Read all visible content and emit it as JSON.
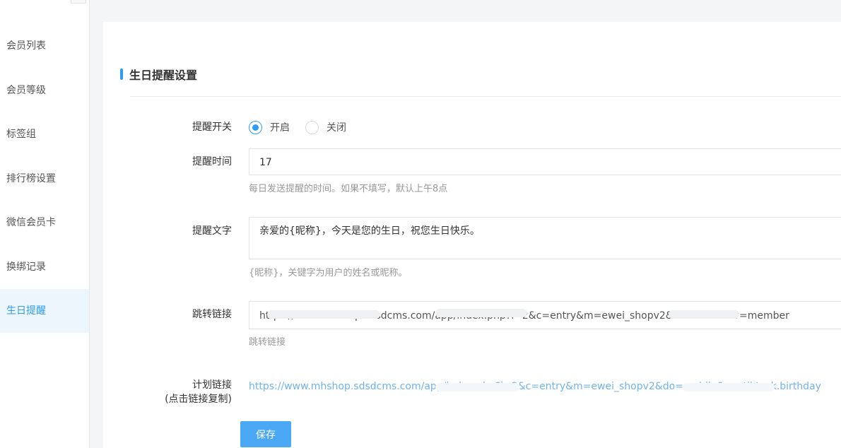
{
  "sidebar": {
    "items": [
      {
        "label": "会员列表",
        "active": false
      },
      {
        "label": "会员等级",
        "active": false
      },
      {
        "label": "标签组",
        "active": false
      },
      {
        "label": "排行榜设置",
        "active": false
      },
      {
        "label": "微信会员卡",
        "active": false
      },
      {
        "label": "换绑记录",
        "active": false
      },
      {
        "label": "生日提醒",
        "active": true
      }
    ]
  },
  "form": {
    "title": "生日提醒设置",
    "switch": {
      "label": "提醒开关",
      "options": [
        "开启",
        "关闭"
      ],
      "selected": "开启"
    },
    "time": {
      "label": "提醒时间",
      "value": "17",
      "help": "每日发送提醒的时间。如果不填写，默认上午8点"
    },
    "text": {
      "label": "提醒文字",
      "value": "亲爱的{昵称}，今天是您的生日，祝您生日快乐。",
      "help": "{昵称}，关键字为用户的姓名或昵称。"
    },
    "jump_link": {
      "label": "跳转链接",
      "value": "https://www.mhshop.sdsdcms.com/app/index.php?i=2&c=entry&m=ewei_shopv2&do=mobile&r=member",
      "help": "跳转链接"
    },
    "plan_link": {
      "label_line1": "计划链接",
      "label_line2": "(点击链接复制)",
      "value": "https://www.mhshop.sdsdcms.com/app/index.php?i=2&c=entry&m=ewei_shopv2&do=mobile&r=util.task.birthday"
    },
    "save_label": "保存"
  },
  "colors": {
    "accent": "#2d9cf2",
    "button": "#4aa8f4",
    "link": "#6fb3ee",
    "help_text": "#999999"
  }
}
